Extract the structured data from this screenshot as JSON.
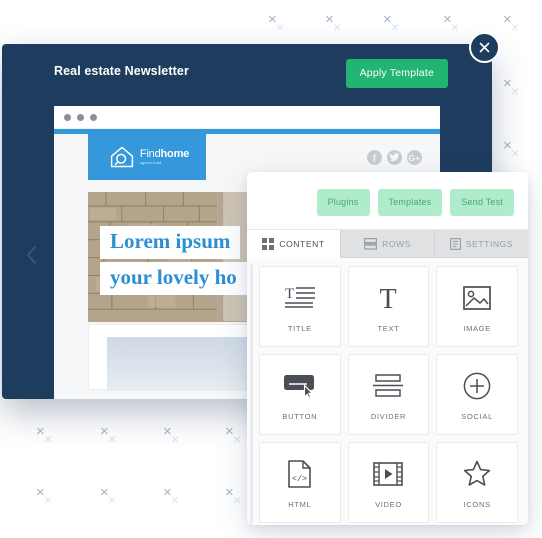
{
  "modal": {
    "title": "Real estate Newsletter",
    "apply_label": "Apply Template",
    "close_icon": "close-x-icon",
    "back_icon": "chevron-left-icon"
  },
  "preview": {
    "window_dots": 3,
    "brand": {
      "name_light": "Find",
      "name_bold": "home",
      "tagline": "agents trust"
    },
    "social": [
      {
        "name": "facebook-icon",
        "glyph": "f"
      },
      {
        "name": "twitter-icon",
        "glyph": "t"
      },
      {
        "name": "googleplus-icon",
        "glyph": "G+"
      }
    ],
    "hero": {
      "line1": "Lorem ipsum",
      "line2": "your lovely ho"
    }
  },
  "panel": {
    "actions": [
      {
        "label": "Plugins",
        "name": "plugins-button"
      },
      {
        "label": "Templates",
        "name": "templates-button"
      },
      {
        "label": "Send Test",
        "name": "send-test-button"
      }
    ],
    "tabs": [
      {
        "label": "CONTENT",
        "icon": "grid-icon",
        "active": true
      },
      {
        "label": "ROWS",
        "icon": "rows-icon",
        "active": false
      },
      {
        "label": "SETTINGS",
        "icon": "list-icon",
        "active": false
      }
    ],
    "blocks": [
      {
        "label": "TITLE",
        "icon": "title-icon"
      },
      {
        "label": "TEXT",
        "icon": "text-icon"
      },
      {
        "label": "IMAGE",
        "icon": "image-icon"
      },
      {
        "label": "BUTTON",
        "icon": "button-icon"
      },
      {
        "label": "DIVIDER",
        "icon": "divider-icon"
      },
      {
        "label": "SOCIAL",
        "icon": "social-plus-icon"
      },
      {
        "label": "HTML",
        "icon": "html-code-icon"
      },
      {
        "label": "VIDEO",
        "icon": "video-icon"
      },
      {
        "label": "ICONS",
        "icon": "star-icon"
      }
    ]
  },
  "colors": {
    "modal_bg": "#1d3c5e",
    "apply_green": "#22b473",
    "action_green_bg": "#aeeccb",
    "action_green_text": "#46a87a",
    "brand_blue": "#3498db",
    "hero_text_blue": "#2b8fd4"
  },
  "decoration": {
    "x_mark": "×",
    "count": 24
  }
}
